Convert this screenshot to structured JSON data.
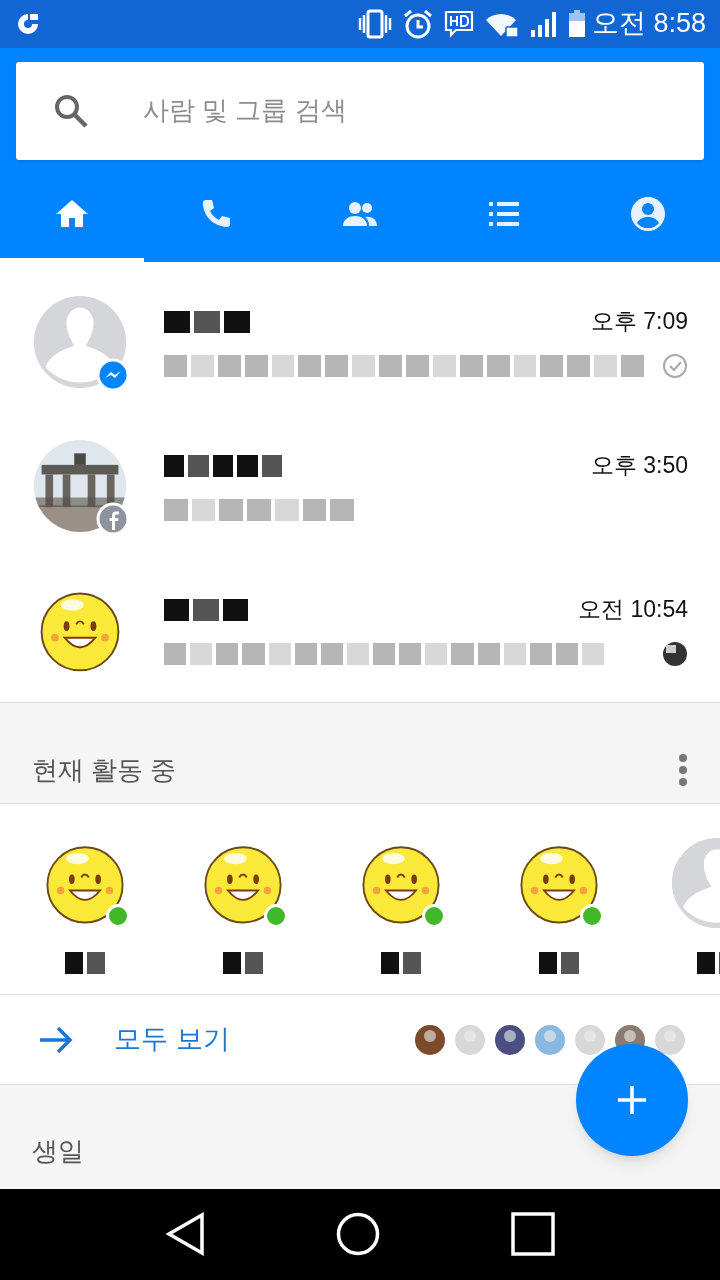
{
  "status_bar": {
    "time": "오전 8:58"
  },
  "search": {
    "placeholder": "사람 및 그룹 검색"
  },
  "tabs": [
    {
      "kind": "home",
      "selected": true
    },
    {
      "kind": "calls",
      "selected": false
    },
    {
      "kind": "groups",
      "selected": false
    },
    {
      "kind": "list",
      "selected": false
    },
    {
      "kind": "profile",
      "selected": false
    }
  ],
  "conversations": [
    {
      "avatar": {
        "kind": "silhouette"
      },
      "badge": {
        "kind": "messenger"
      },
      "time": "오후 7:09",
      "receipt": {
        "kind": "check"
      }
    },
    {
      "badge": {
        "kind": "facebook"
      },
      "time": "오후 3:50"
    },
    {
      "avatar": {
        "kind": "emoji"
      },
      "time": "오전 10:54",
      "receipt": {
        "kind": "avatar"
      }
    }
  ],
  "active_now": {
    "title": "현재 활동 중",
    "people": [
      {
        "avatar": {
          "kind": "emoji"
        },
        "online": true
      },
      {
        "avatar": {
          "kind": "emoji"
        },
        "online": true
      },
      {
        "avatar": {
          "kind": "emoji"
        },
        "online": true
      },
      {
        "avatar": {
          "kind": "emoji"
        },
        "online": true
      },
      {
        "avatar": {
          "kind": "silhouette"
        },
        "online": false
      }
    ]
  },
  "see_all": {
    "label": "모두 보기"
  },
  "birthdays": {
    "title": "생일"
  }
}
